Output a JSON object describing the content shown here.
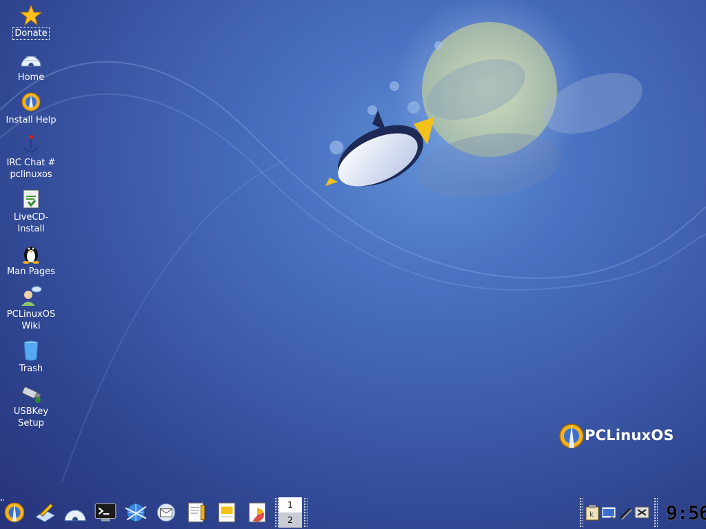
{
  "desktop": {
    "icons": [
      {
        "label": "Donate"
      },
      {
        "label": "Home"
      },
      {
        "label": "Install Help"
      },
      {
        "label_line1": "IRC Chat #",
        "label_line2": "pclinuxos"
      },
      {
        "label_line1": "LiveCD-",
        "label_line2": "Install"
      },
      {
        "label": "Man Pages"
      },
      {
        "label_line1": "PCLinuxOS",
        "label_line2": "Wiki"
      },
      {
        "label": "Trash"
      },
      {
        "label_line1": "USBKey",
        "label_line2": "Setup"
      }
    ]
  },
  "logo": {
    "text": "PCLinuxOS"
  },
  "taskbar": {
    "launchers": [
      "pclinuxos-menu-icon",
      "kwrite-icon",
      "home-igloo-icon",
      "terminal-icon",
      "web-browser-icon",
      "email-icon",
      "word-processor-icon",
      "presentation-icon",
      "chart-document-icon"
    ],
    "pager": {
      "desktop1": "1",
      "desktop2": "2"
    },
    "clock": {
      "time": "9:56"
    }
  },
  "colors": {
    "background_top": "#5f8fd6",
    "background_bottom": "#26337a",
    "text": "#ffffff"
  }
}
